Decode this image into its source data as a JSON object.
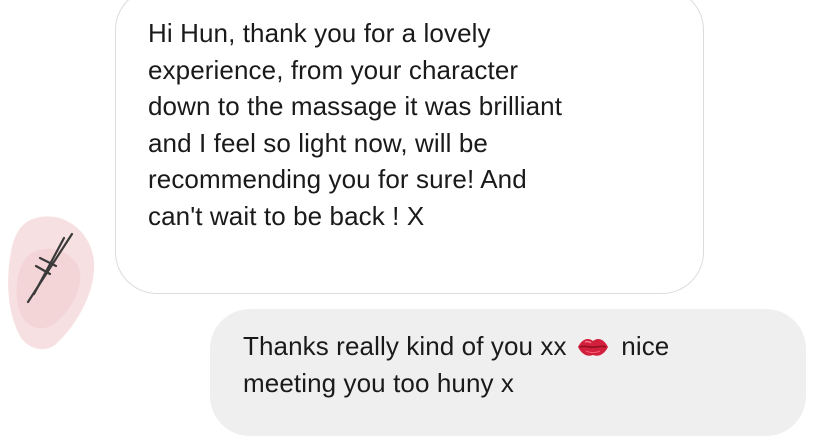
{
  "conversation": {
    "incoming_message": {
      "text": "Hi Hun, thank you for a lovely\nexperience, from your character\ndown to the massage it was brilliant\nand I  feel so light now, will be\nrecommending you for sure! And\ncan't wait to be back ! X"
    },
    "outgoing_message": {
      "text_before_emoji": "Thanks really kind of you xx ",
      "emoji": "lips-kiss-icon",
      "text_after_emoji": " nice\nmeeting you too huny x"
    }
  },
  "colors": {
    "incoming_bubble_bg": "#ffffff",
    "incoming_bubble_border": "#dcdcdc",
    "outgoing_bubble_bg": "#efefef",
    "text": "#1a1a1a",
    "avatar_blob": "#f4d6d8"
  }
}
